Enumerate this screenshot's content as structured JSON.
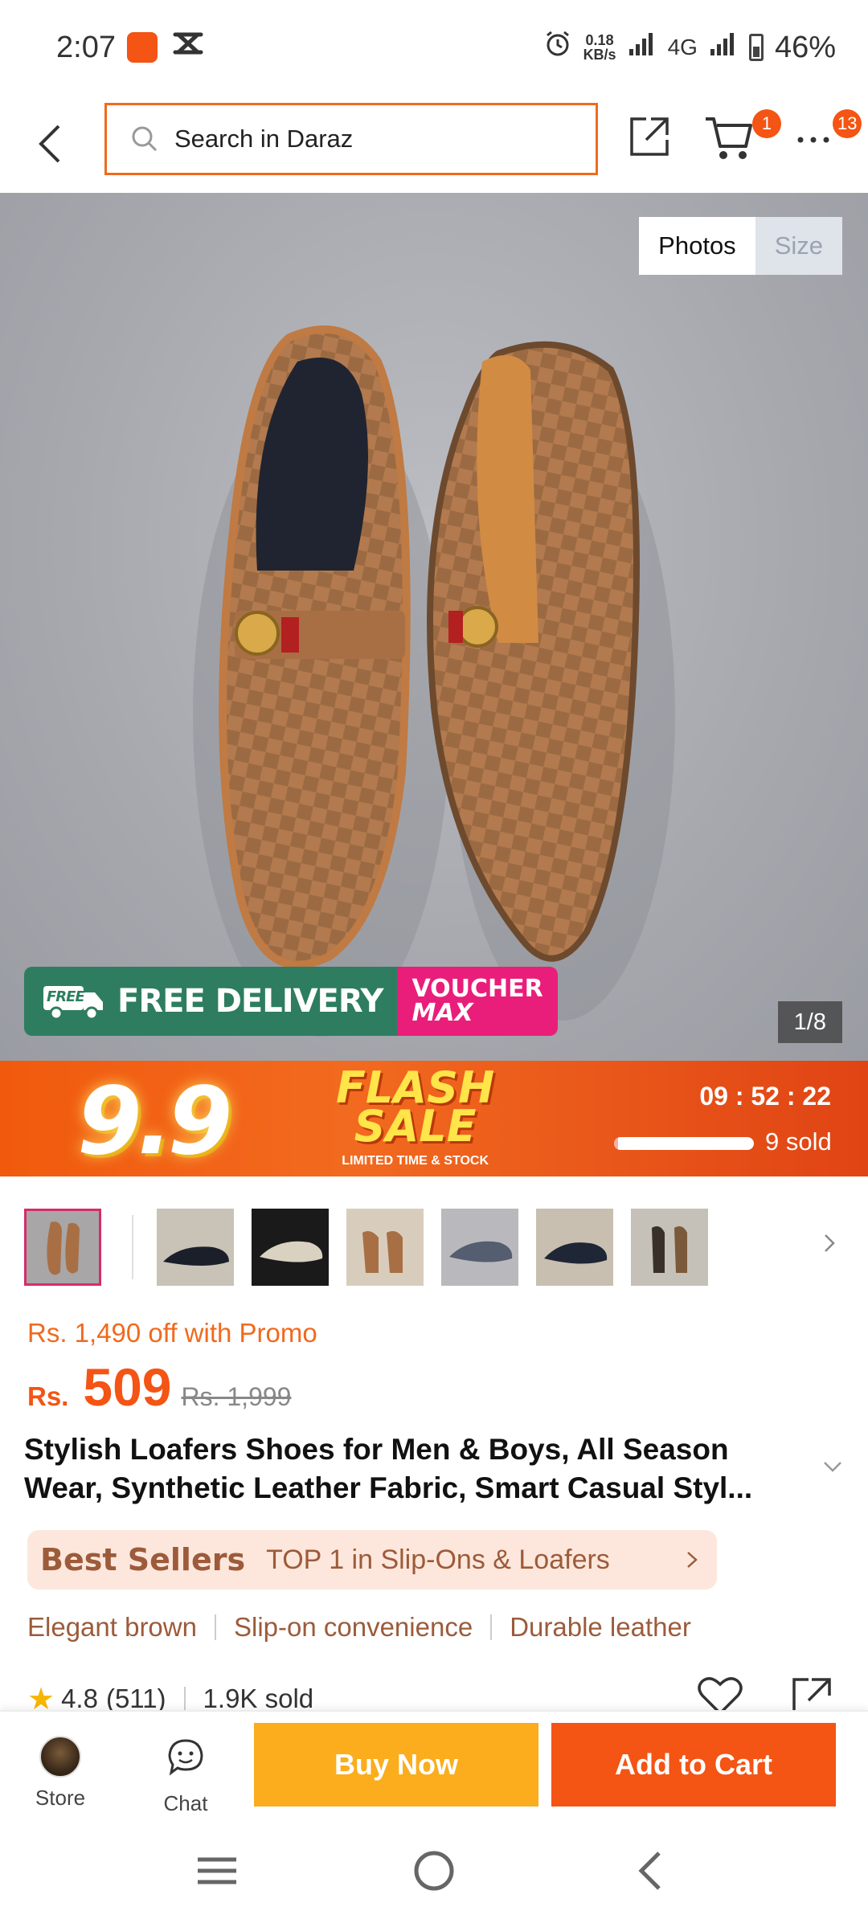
{
  "status_bar": {
    "time": "2:07",
    "net_speed_value": "0.18",
    "net_speed_unit": "KB/s",
    "network": "4G",
    "battery": "46%"
  },
  "top_nav": {
    "search_placeholder": "Search in Daraz",
    "cart_badge": "1",
    "more_badge": "13"
  },
  "hero": {
    "tab_photos": "Photos",
    "tab_size": "Size",
    "free_badge": "FREE",
    "free_delivery": "FREE DELIVERY",
    "voucher_line1": "VOUCHER",
    "voucher_line2": "MAX",
    "counter": "1/8"
  },
  "flash_sale": {
    "event": "9.9",
    "title_line1": "FLASH",
    "title_line2": "SALE",
    "subtitle": "LIMITED TIME & STOCK",
    "timer": "09 : 52 : 22",
    "sold": "9 sold",
    "progress": 0.03
  },
  "product": {
    "promo": "Rs. 1,490 off with Promo",
    "currency": "Rs.",
    "price": "509",
    "old_price": "Rs. 1,999",
    "title": "Stylish Loafers Shoes for Men & Boys, All Season Wear, Synthetic Leather Fabric, Smart Casual Styl...",
    "best_seller_label": "Best Sellers",
    "best_seller_text": "TOP 1 in Slip-Ons & Loafers",
    "highlights": [
      "Elegant brown",
      "Slip-on convenience",
      "Durable leather"
    ],
    "rating": "4.8",
    "reviews": "(511)",
    "sold": "1.9K sold"
  },
  "action_bar": {
    "store": "Store",
    "chat": "Chat",
    "buy_now": "Buy Now",
    "add_to_cart": "Add to Cart"
  },
  "colors": {
    "accent": "#f45414",
    "buy_now": "#fbad1d",
    "search_border": "#f06a1d",
    "best_seller_bg": "#fde7dc"
  }
}
